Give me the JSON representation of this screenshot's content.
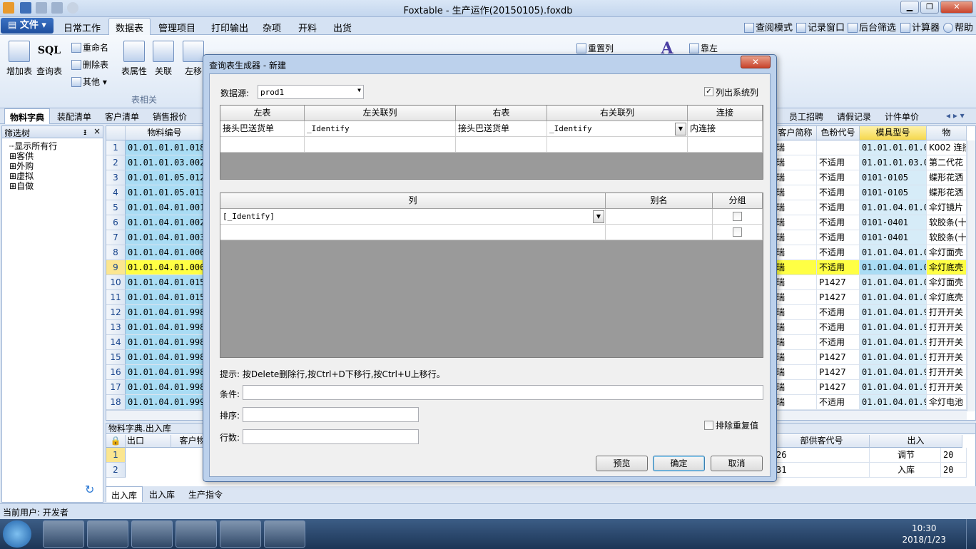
{
  "window": {
    "title": "Foxtable - 生产运作(20150105).foxdb"
  },
  "menu": {
    "file": "文件",
    "tabs": [
      "日常工作",
      "数据表",
      "管理项目",
      "打印输出",
      "杂项",
      "开料",
      "出货"
    ],
    "active_tab": "数据表",
    "right_links": [
      "查阅模式",
      "记录窗口",
      "后台筛选",
      "计算器",
      "帮助"
    ]
  },
  "ribbon": {
    "add_table": "增加表",
    "query_table": "查询表",
    "sql": "SQL",
    "rename": "重命名",
    "delete_table": "删除表",
    "other": "其他",
    "table_props": "表属性",
    "relation": "关联",
    "move_left": "左移",
    "reset_cols": "重置列",
    "dock_left": "靠左",
    "group_label": "表相关"
  },
  "sheet_tabs": {
    "left": [
      "物料字典",
      "装配清单",
      "客户清单",
      "销售报价"
    ],
    "right": [
      "员工招聘",
      "请假记录",
      "计件单价"
    ],
    "active": "物料字典"
  },
  "filter_panel": {
    "title": "筛选树",
    "pin": "ᵻ",
    "close": "×",
    "items": [
      "显示所有行",
      "客供",
      "外购",
      "虚拟",
      "自做"
    ]
  },
  "grid": {
    "left_header": "物料编号",
    "right_headers": [
      "客户简称",
      "色粉代号",
      "模具型号",
      "物"
    ],
    "rows": [
      {
        "n": "1",
        "code": "01.01.01.01.018",
        "cust": "瑞",
        "color": "",
        "mold": "01.01.01.01.01",
        "name": "K002 连接"
      },
      {
        "n": "2",
        "code": "01.01.01.03.002",
        "cust": "瑞",
        "color": "不适用",
        "mold": "01.01.01.03.00",
        "name": "第二代花"
      },
      {
        "n": "3",
        "code": "01.01.01.05.012",
        "cust": "瑞",
        "color": "不适用",
        "mold": "0101-0105",
        "name": "蝶形花洒"
      },
      {
        "n": "4",
        "code": "01.01.01.05.013",
        "cust": "瑞",
        "color": "不适用",
        "mold": "0101-0105",
        "name": "蝶形花洒"
      },
      {
        "n": "5",
        "code": "01.01.04.01.001",
        "cust": "瑞",
        "color": "不适用",
        "mold": "01.01.04.01.00",
        "name": "伞灯镜片"
      },
      {
        "n": "6",
        "code": "01.01.04.01.002",
        "cust": "瑞",
        "color": "不适用",
        "mold": "0101-0401",
        "name": "软胶条(十"
      },
      {
        "n": "7",
        "code": "01.01.04.01.003",
        "cust": "瑞",
        "color": "不适用",
        "mold": "0101-0401",
        "name": "软胶条(十"
      },
      {
        "n": "8",
        "code": "01.01.04.01.006-1",
        "cust": "瑞",
        "color": "不适用",
        "mold": "01.01.04.01.01",
        "name": "伞灯面壳"
      },
      {
        "n": "9",
        "code": "01.01.04.01.006-2",
        "cust": "瑞",
        "color": "不适用",
        "mold": "01.01.04.01.01",
        "name": "伞灯底壳"
      },
      {
        "n": "10",
        "code": "01.01.04.01.015-1",
        "cust": "瑞",
        "color": "P1427",
        "mold": "01.01.04.01.01",
        "name": "伞灯面壳"
      },
      {
        "n": "11",
        "code": "01.01.04.01.015-2",
        "cust": "瑞",
        "color": "P1427",
        "mold": "01.01.04.01.01",
        "name": "伞灯底壳"
      },
      {
        "n": "12",
        "code": "01.01.04.01.998-1A",
        "cust": "瑞",
        "color": "不适用",
        "mold": "01.01.04.01.99",
        "name": "打开开关"
      },
      {
        "n": "13",
        "code": "01.01.04.01.998-1B",
        "cust": "瑞",
        "color": "不适用",
        "mold": "01.01.04.01.99",
        "name": "打开开关"
      },
      {
        "n": "14",
        "code": "01.01.04.01.998-1C",
        "cust": "瑞",
        "color": "不适用",
        "mold": "01.01.04.01.99",
        "name": "打开开关"
      },
      {
        "n": "15",
        "code": "01.01.04.01.998-2A",
        "cust": "瑞",
        "color": "P1427",
        "mold": "01.01.04.01.99",
        "name": "打开开关"
      },
      {
        "n": "16",
        "code": "01.01.04.01.998-2B",
        "cust": "瑞",
        "color": "P1427",
        "mold": "01.01.04.01.99",
        "name": "打开开关"
      },
      {
        "n": "17",
        "code": "01.01.04.01.998-2C",
        "cust": "瑞",
        "color": "P1427",
        "mold": "01.01.04.01.99",
        "name": "打开开关"
      },
      {
        "n": "18",
        "code": "01.01.04.01.999-1",
        "cust": "瑞",
        "color": "不适用",
        "mold": "01.01.04.01.99",
        "name": "伞灯电池"
      }
    ],
    "selected_row": 9
  },
  "lower": {
    "title": "物料字典.出入库",
    "headers": [
      "出口",
      "客户物"
    ],
    "right_headers": [
      "部供客代号",
      "出入"
    ],
    "right_rows": [
      [
        "26",
        "调节",
        "20"
      ],
      [
        "31",
        "入库",
        "20"
      ]
    ],
    "row_numbers": [
      "1",
      "2"
    ],
    "tabs": [
      "出入库",
      "出入库",
      "生产指令"
    ]
  },
  "status": {
    "text": "当前用户:  开发者"
  },
  "taskbar": {
    "time": "10:30",
    "date": "2018/1/23"
  },
  "dialog": {
    "title": "查询表生成器 - 新建",
    "datasource_label": "数据源:",
    "datasource_value": "prod1",
    "show_system_cols": "列出系统列",
    "join_headers": [
      "左表",
      "左关联列",
      "右表",
      "右关联列",
      "连接"
    ],
    "join_row": [
      "接头巴送货单",
      "_Identify",
      "接头巴送货单",
      "_Identify",
      "内连接"
    ],
    "col_headers": [
      "列",
      "别名",
      "分组"
    ],
    "col_row": [
      "[_Identify]",
      "",
      ""
    ],
    "hint": "提示: 按Delete删除行,按Ctrl+D下移行,按Ctrl+U上移行。",
    "condition_label": "条件:",
    "sort_label": "排序:",
    "rows_label": "行数:",
    "distinct_label": "排除重复值",
    "preview": "预览",
    "ok": "确定",
    "cancel": "取消"
  }
}
